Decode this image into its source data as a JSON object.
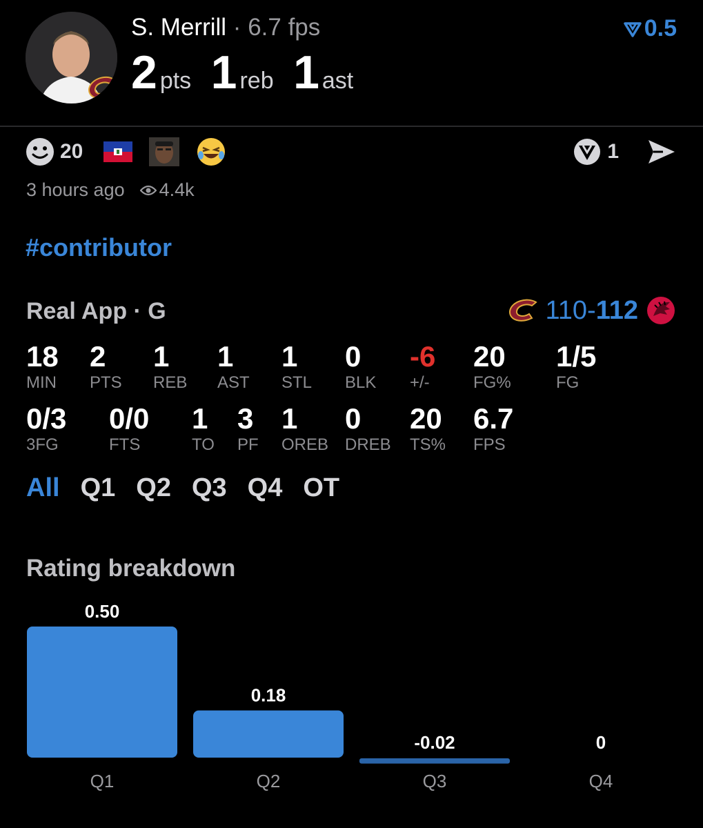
{
  "header": {
    "player_name": "S. Merrill",
    "separator": "·",
    "fps_text": "6.7 fps",
    "pts_value": "2",
    "pts_unit": "pts",
    "reb_value": "1",
    "reb_unit": "reb",
    "ast_value": "1",
    "ast_unit": "ast",
    "rating": "0.5"
  },
  "social": {
    "reaction_count": "20",
    "vote_count": "1",
    "time_ago": "3 hours ago",
    "views": "4.4k"
  },
  "post": {
    "hashtag": "#contributor"
  },
  "game": {
    "source": "Real App · G",
    "score_home": "110-",
    "score_away": "112"
  },
  "stats_row1": [
    {
      "value": "18",
      "label": "MIN"
    },
    {
      "value": "2",
      "label": "PTS"
    },
    {
      "value": "1",
      "label": "REB"
    },
    {
      "value": "1",
      "label": "AST"
    },
    {
      "value": "1",
      "label": "STL"
    },
    {
      "value": "0",
      "label": "BLK"
    },
    {
      "value": "-6",
      "label": "+/-"
    },
    {
      "value": "20",
      "label": "FG%"
    },
    {
      "value": "1/5",
      "label": "FG"
    }
  ],
  "stats_row2": [
    {
      "value": "0/3",
      "label": "3FG"
    },
    {
      "value": "0/0",
      "label": "FTS"
    },
    {
      "value": "1",
      "label": "TO"
    },
    {
      "value": "3",
      "label": "PF"
    },
    {
      "value": "1",
      "label": "OREB"
    },
    {
      "value": "0",
      "label": "DREB"
    },
    {
      "value": "20",
      "label": "TS%"
    },
    {
      "value": "6.7",
      "label": "FPS"
    }
  ],
  "quarter_tabs": [
    "All",
    "Q1",
    "Q2",
    "Q3",
    "Q4",
    "OT"
  ],
  "active_tab": "All",
  "rating_breakdown_title": "Rating breakdown",
  "colors": {
    "accent": "#3a86d8",
    "negative": "#e0312c",
    "bar": "#3a86d8",
    "bar_small": "#2a64a8"
  },
  "icons": {
    "rating": "downvote-arrow-icon",
    "reaction": "smiley-icon",
    "flag": "haiti-flag-icon",
    "meme": "face-meme-icon",
    "laugh": "laughing-emoji-icon",
    "vote": "vote-badge-icon",
    "share": "send-arrow-icon",
    "views": "eye-icon",
    "team_home": "cavaliers-logo-icon",
    "team_away": "raptors-logo-icon"
  },
  "chart_data": {
    "type": "bar",
    "categories": [
      "Q1",
      "Q2",
      "Q3",
      "Q4"
    ],
    "values": [
      0.5,
      0.18,
      -0.02,
      0
    ],
    "value_labels": [
      "0.50",
      "0.18",
      "-0.02",
      "0"
    ],
    "ylim": [
      0,
      0.5
    ],
    "grid": false
  }
}
